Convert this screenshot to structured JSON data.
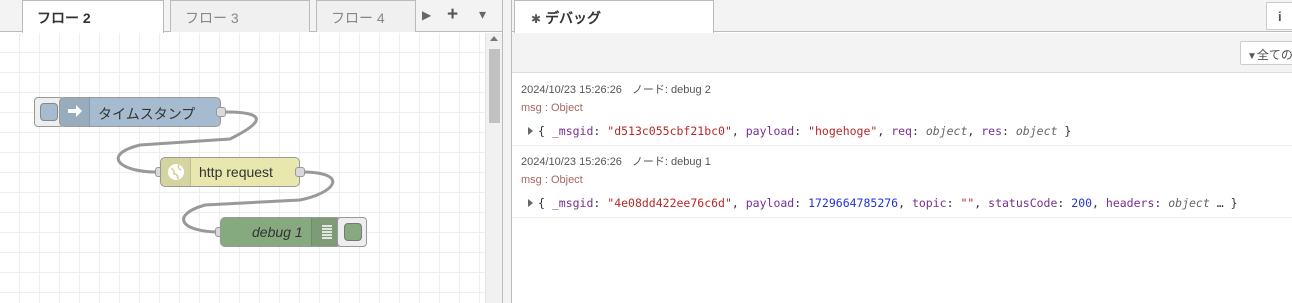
{
  "tabs": [
    {
      "label": "フロー 2"
    },
    {
      "label": "フロー 3"
    },
    {
      "label": "フロー 4"
    }
  ],
  "tab_controls": {
    "scroll_right": "▶",
    "add": "+",
    "menu": "▾"
  },
  "nodes": {
    "inject": {
      "label": "タイムスタンプ",
      "color": "#a6bbcf"
    },
    "http": {
      "label": "http request",
      "color": "#e7e7ae"
    },
    "debug": {
      "label": "debug 1",
      "color": "#87a980"
    }
  },
  "sidebar": {
    "tab_label": "デバッグ",
    "info_icon": "i",
    "filter_label": "全ての"
  },
  "messages": [
    {
      "timestamp": "2024/10/23 15:26:26",
      "node": "ノード: debug 2",
      "type": "msg : Object",
      "fields": [
        {
          "key": "_msgid",
          "value": "\"d513c055cbf21bc0\"",
          "kind": "string"
        },
        {
          "key": "payload",
          "value": "\"hogehoge\"",
          "kind": "string"
        },
        {
          "key": "req",
          "value": "object",
          "kind": "type"
        },
        {
          "key": "res",
          "value": "object",
          "kind": "type"
        }
      ],
      "suffix": ""
    },
    {
      "timestamp": "2024/10/23 15:26:26",
      "node": "ノード: debug 1",
      "type": "msg : Object",
      "fields": [
        {
          "key": "_msgid",
          "value": "\"4e08dd422ee76c6d\"",
          "kind": "string"
        },
        {
          "key": "payload",
          "value": "1729664785276",
          "kind": "number"
        },
        {
          "key": "topic",
          "value": "\"\"",
          "kind": "string"
        },
        {
          "key": "statusCode",
          "value": "200",
          "kind": "number"
        },
        {
          "key": "headers",
          "value": "object",
          "kind": "type"
        }
      ],
      "suffix": "…"
    }
  ]
}
